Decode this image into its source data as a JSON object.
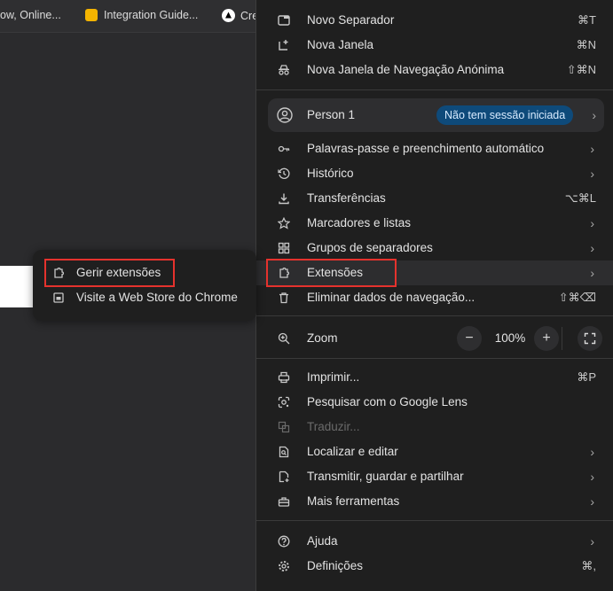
{
  "bookmarks": [
    {
      "label": "ow, Online...",
      "icon": "blank",
      "color": ""
    },
    {
      "label": "Integration Guide...",
      "icon": "slides-icon",
      "color": "#f4b400"
    },
    {
      "label": "Cre",
      "icon": "triangle-logo-icon",
      "color": "#ffffff"
    }
  ],
  "menu": {
    "items_top": [
      {
        "label": "Novo Separador",
        "shortcut": "⌘T",
        "icon": "new-tab-icon"
      },
      {
        "label": "Nova Janela",
        "shortcut": "⌘N",
        "icon": "new-window-icon"
      },
      {
        "label": "Nova Janela de Navegação Anónima",
        "shortcut": "⇧⌘N",
        "icon": "incognito-icon"
      }
    ],
    "profile": {
      "name": "Person 1",
      "status": "Não tem sessão iniciada",
      "icon": "person-icon"
    },
    "items_mid": [
      {
        "label": "Palavras-passe e preenchimento automático",
        "icon": "key-icon",
        "shortcut": ""
      },
      {
        "label": "Histórico",
        "icon": "history-icon",
        "shortcut": ""
      },
      {
        "label": "Transferências",
        "icon": "download-icon",
        "shortcut": "⌥⌘L"
      },
      {
        "label": "Marcadores e listas",
        "icon": "star-icon",
        "shortcut": ""
      },
      {
        "label": "Grupos de separadores",
        "icon": "tab-groups-icon",
        "shortcut": ""
      },
      {
        "label": "Extensões",
        "icon": "extension-icon",
        "shortcut": ""
      },
      {
        "label": "Eliminar dados de navegação...",
        "icon": "trash-icon",
        "shortcut": "⇧⌘⌫"
      }
    ],
    "zoom": {
      "label": "Zoom",
      "value": "100%",
      "minus": "−",
      "plus": "+"
    },
    "items_tools": [
      {
        "label": "Imprimir...",
        "icon": "print-icon",
        "shortcut": "⌘P"
      },
      {
        "label": "Pesquisar com o Google Lens",
        "icon": "lens-icon",
        "shortcut": ""
      },
      {
        "label": "Traduzir...",
        "icon": "translate-icon",
        "shortcut": ""
      },
      {
        "label": "Localizar e editar",
        "icon": "find-icon",
        "shortcut": ""
      },
      {
        "label": "Transmitir, guardar e partilhar",
        "icon": "cast-icon",
        "shortcut": ""
      },
      {
        "label": "Mais ferramentas",
        "icon": "toolbox-icon",
        "shortcut": ""
      }
    ],
    "items_bottom": [
      {
        "label": "Ajuda",
        "icon": "help-icon",
        "shortcut": ""
      },
      {
        "label": "Definições",
        "icon": "settings-icon",
        "shortcut": "⌘,"
      }
    ]
  },
  "submenu": {
    "items": [
      {
        "label": "Gerir extensões",
        "icon": "extension-icon"
      },
      {
        "label": "Visite a Web Store do Chrome",
        "icon": "web-store-icon"
      }
    ]
  },
  "colors": {
    "highlight_box": "#e5322d",
    "badge_bg": "#0e4a7a",
    "menu_bg": "#1f1f1f"
  }
}
